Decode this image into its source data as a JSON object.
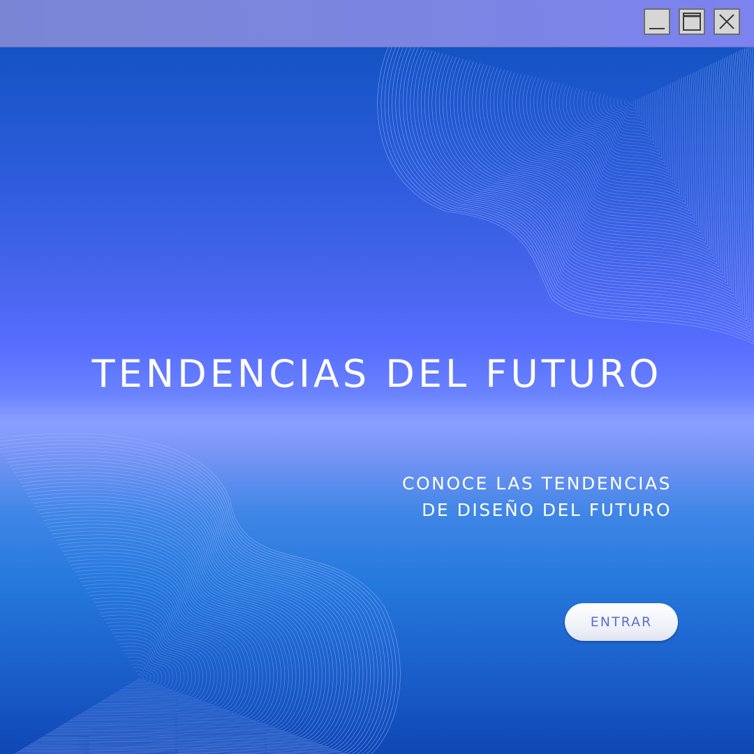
{
  "window": {
    "controls": [
      {
        "name": "minimize",
        "icon": "minimize-icon"
      },
      {
        "name": "maximize",
        "icon": "maximize-icon"
      },
      {
        "name": "close",
        "icon": "close-icon"
      }
    ]
  },
  "hero": {
    "title": "TENDENCIAS DEL FUTURO",
    "subtitle_line1": "CONOCE LAS TENDENCIAS",
    "subtitle_line2": "DE DISEÑO DEL FUTURO",
    "button_label": "ENTRAR"
  },
  "colors": {
    "titlebar": "#7b85e2",
    "background_top": "#1453c4",
    "background_mid": "#566dff",
    "background_bottom": "#0f47b5",
    "text": "#ffffff",
    "button_text": "#5a6fc9"
  }
}
